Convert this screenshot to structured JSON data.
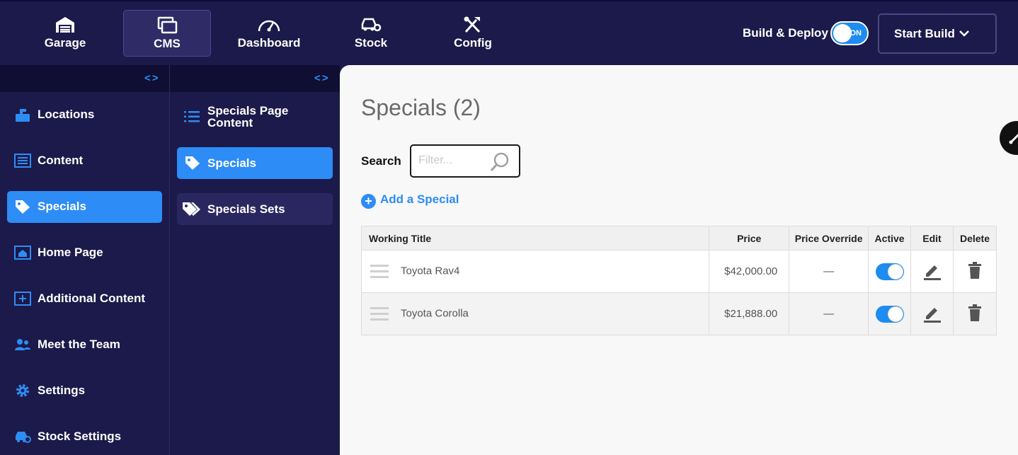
{
  "topnav": {
    "tabs": [
      {
        "label": "Garage",
        "icon": "garage-icon"
      },
      {
        "label": "CMS",
        "icon": "cms-icon",
        "active": true
      },
      {
        "label": "Dashboard",
        "icon": "speedometer-icon"
      },
      {
        "label": "Stock",
        "icon": "car-gear-icon"
      },
      {
        "label": "Config",
        "icon": "tools-icon"
      }
    ],
    "build_deploy_label": "Build & Deploy",
    "toggle_state": "ON",
    "start_build_label": "Start Build"
  },
  "sidebar": {
    "collapse_glyph": "<>",
    "items": [
      {
        "label": "Locations",
        "icon": "location-icon"
      },
      {
        "label": "Content",
        "icon": "content-icon"
      },
      {
        "label": "Specials",
        "icon": "tag-icon",
        "active": true
      },
      {
        "label": "Home Page",
        "icon": "home-page-icon"
      },
      {
        "label": "Additional Content",
        "icon": "add-content-icon"
      },
      {
        "label": "Meet the Team",
        "icon": "team-icon"
      },
      {
        "label": "Settings",
        "icon": "gear-icon"
      },
      {
        "label": "Stock Settings",
        "icon": "stock-settings-icon"
      }
    ]
  },
  "subnav": {
    "collapse_glyph": "<>",
    "items": [
      {
        "label": "Specials Page Content",
        "line1": "Specials Page",
        "line2": "Content",
        "icon": "list-icon"
      },
      {
        "label": "Specials",
        "icon": "tag-icon",
        "active": true
      },
      {
        "label": "Specials Sets",
        "icon": "tags-icon"
      }
    ]
  },
  "main": {
    "title": "Specials (2)",
    "search_label": "Search",
    "search_placeholder": "Filter...",
    "add_label": "Add a Special",
    "table": {
      "headers": [
        "Working Title",
        "Price",
        "Price Override",
        "Active",
        "Edit",
        "Delete"
      ],
      "rows": [
        {
          "title": "Toyota Rav4",
          "price": "$42,000.00",
          "override": "—",
          "active": true
        },
        {
          "title": "Toyota Corolla",
          "price": "$21,888.00",
          "override": "—",
          "active": true
        }
      ]
    }
  },
  "colors": {
    "navy": "#1c1a4a",
    "accent": "#2d8cf5",
    "main_bg": "#f8f8f8"
  }
}
